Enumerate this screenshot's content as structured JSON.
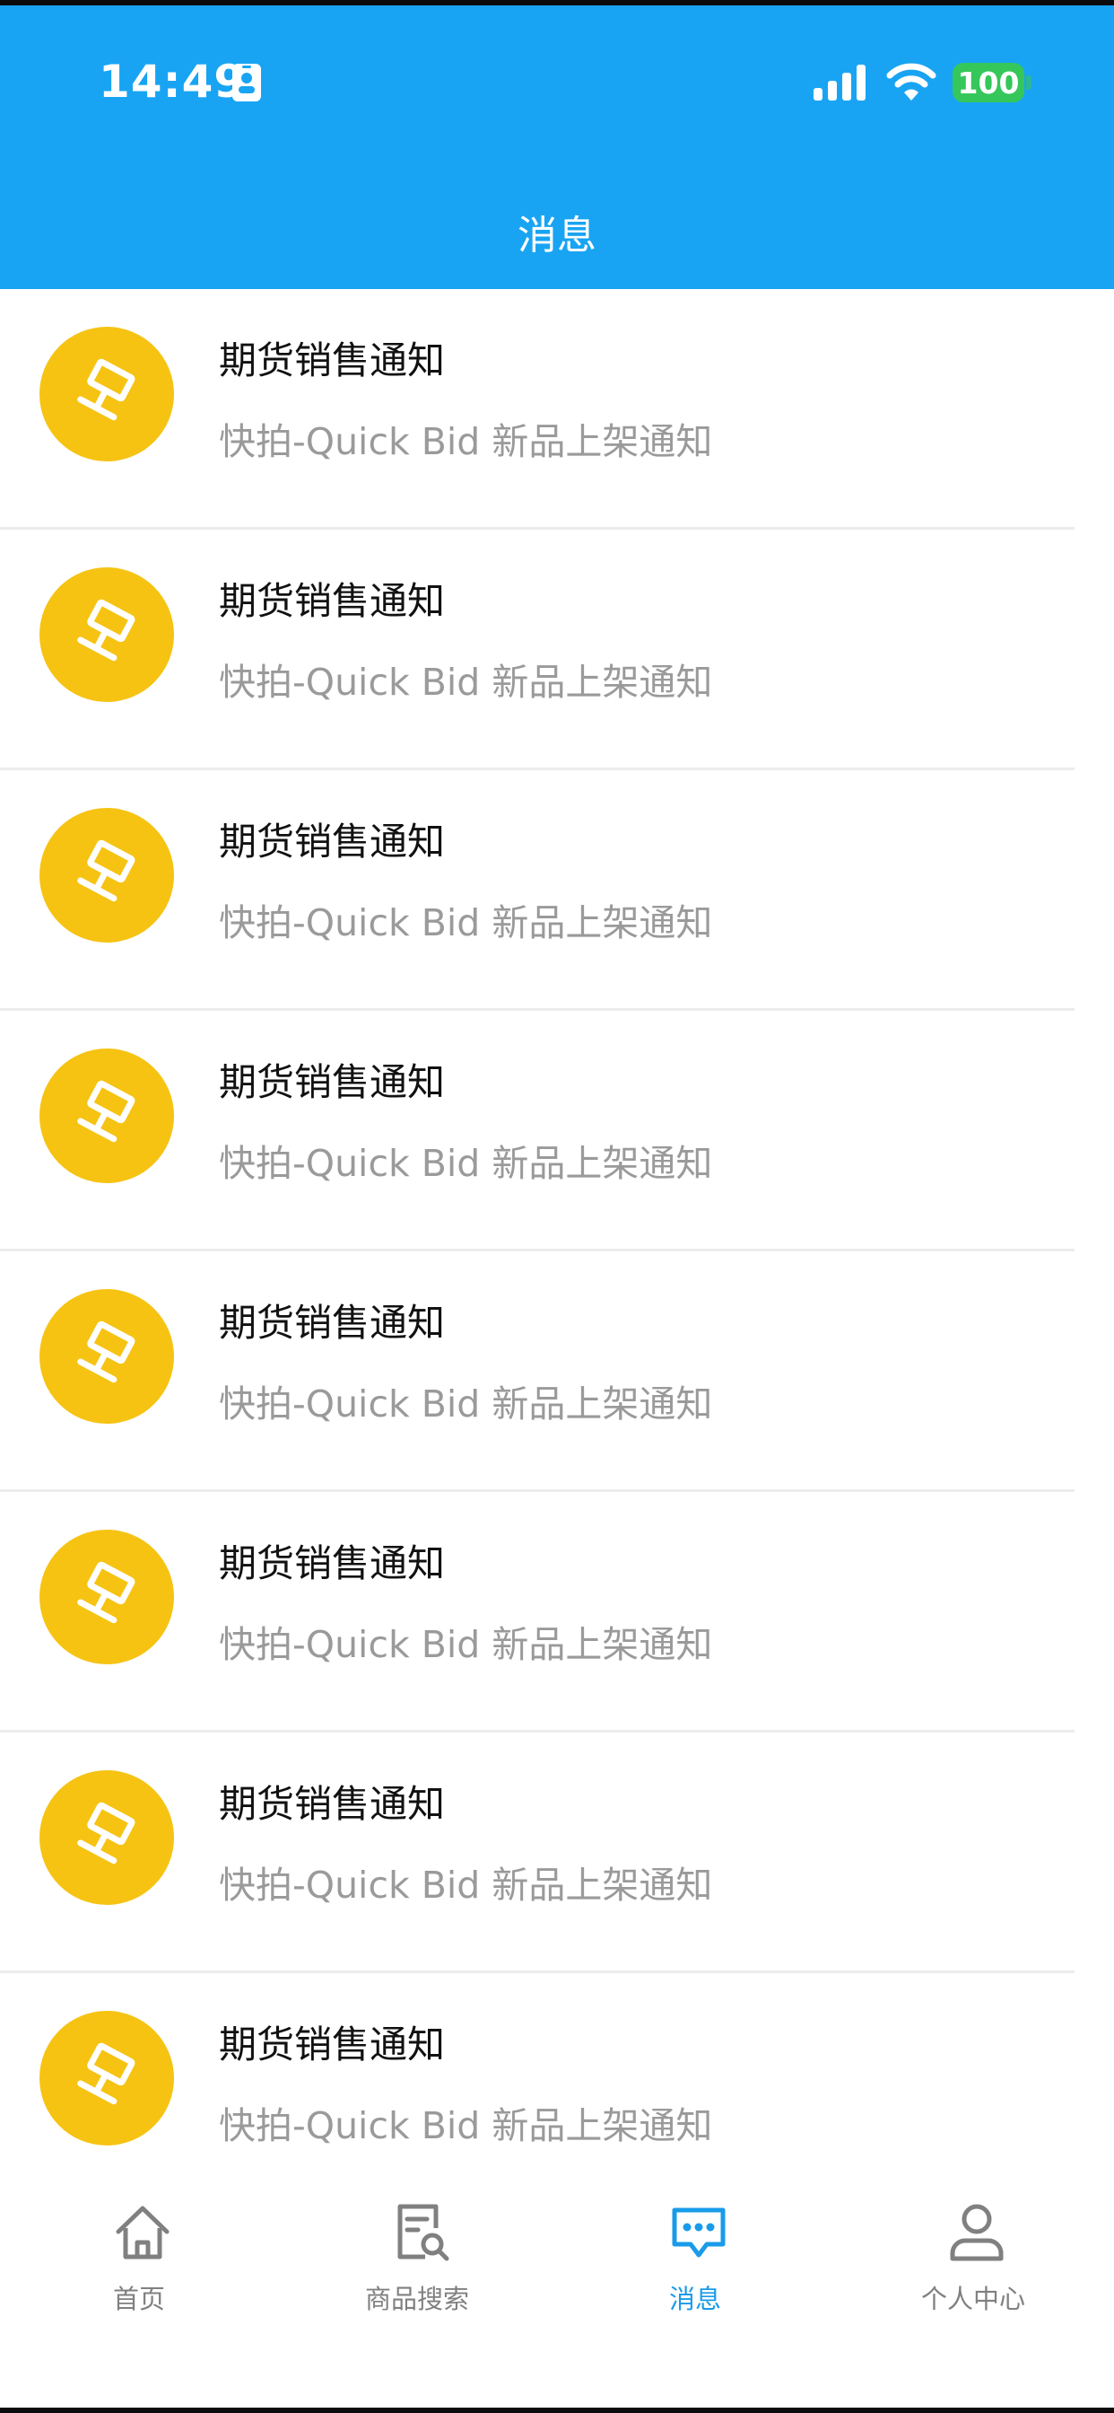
{
  "status_bar": {
    "time": "14:49",
    "battery": "100",
    "icons": [
      "id-card-icon",
      "cellular-signal-icon",
      "wifi-icon",
      "battery-icon"
    ]
  },
  "header": {
    "title": "消息"
  },
  "colors": {
    "header_bg": "#19a4f3",
    "avatar_bg": "#f6c313",
    "active_tab": "#1a9bea",
    "inactive_tab": "#808080",
    "battery": "#35c75a"
  },
  "messages": [
    {
      "title": "期货销售通知",
      "subtitle": "快拍-Quick Bid 新品上架通知",
      "icon": "gavel-icon"
    },
    {
      "title": "期货销售通知",
      "subtitle": "快拍-Quick Bid 新品上架通知",
      "icon": "gavel-icon"
    },
    {
      "title": "期货销售通知",
      "subtitle": "快拍-Quick Bid 新品上架通知",
      "icon": "gavel-icon"
    },
    {
      "title": "期货销售通知",
      "subtitle": "快拍-Quick Bid 新品上架通知",
      "icon": "gavel-icon"
    },
    {
      "title": "期货销售通知",
      "subtitle": "快拍-Quick Bid 新品上架通知",
      "icon": "gavel-icon"
    },
    {
      "title": "期货销售通知",
      "subtitle": "快拍-Quick Bid 新品上架通知",
      "icon": "gavel-icon"
    },
    {
      "title": "期货销售通知",
      "subtitle": "快拍-Quick Bid 新品上架通知",
      "icon": "gavel-icon"
    },
    {
      "title": "期货销售通知",
      "subtitle": "快拍-Quick Bid 新品上架通知",
      "icon": "gavel-icon"
    }
  ],
  "tabbar": {
    "tabs": [
      {
        "label": "首页",
        "icon": "home-icon",
        "active": false
      },
      {
        "label": "商品搜索",
        "icon": "product-search-icon",
        "active": false
      },
      {
        "label": "消息",
        "icon": "message-icon",
        "active": true
      },
      {
        "label": "个人中心",
        "icon": "user-icon",
        "active": false
      }
    ]
  }
}
